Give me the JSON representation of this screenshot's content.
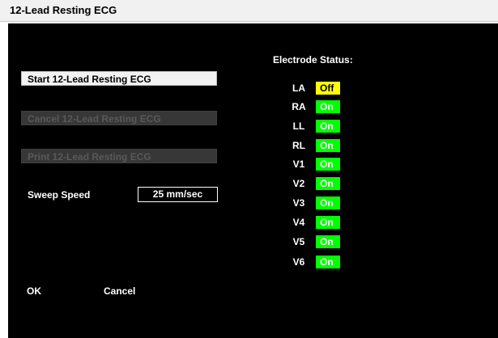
{
  "window": {
    "title": "12-Lead Resting ECG"
  },
  "actions": {
    "start_label": "Start 12-Lead Resting ECG",
    "cancel_label": "Cancel 12-Lead Resting ECG",
    "print_label": "Print 12-Lead Resting ECG"
  },
  "sweep": {
    "label": "Sweep Speed",
    "value": "25 mm/sec"
  },
  "electrodes": {
    "heading": "Electrode Status:",
    "items": [
      {
        "lead": "LA",
        "status": "Off",
        "color": "#ffff00",
        "text_color": "#000000"
      },
      {
        "lead": "RA",
        "status": "On",
        "color": "#00ff00",
        "text_color": "#ffffff"
      },
      {
        "lead": "LL",
        "status": "On",
        "color": "#00ff00",
        "text_color": "#ffffff"
      },
      {
        "lead": "RL",
        "status": "On",
        "color": "#00ff00",
        "text_color": "#ffffff"
      },
      {
        "lead": "V1",
        "status": "On",
        "color": "#00ff00",
        "text_color": "#ffffff"
      },
      {
        "lead": "V2",
        "status": "On",
        "color": "#00ff00",
        "text_color": "#ffffff"
      },
      {
        "lead": "V3",
        "status": "On",
        "color": "#00ff00",
        "text_color": "#ffffff"
      },
      {
        "lead": "V4",
        "status": "On",
        "color": "#00ff00",
        "text_color": "#ffffff"
      },
      {
        "lead": "V5",
        "status": "On",
        "color": "#00ff00",
        "text_color": "#ffffff"
      },
      {
        "lead": "V6",
        "status": "On",
        "color": "#00ff00",
        "text_color": "#ffffff"
      }
    ]
  },
  "dialog": {
    "ok_label": "OK",
    "cancel_label": "Cancel"
  }
}
